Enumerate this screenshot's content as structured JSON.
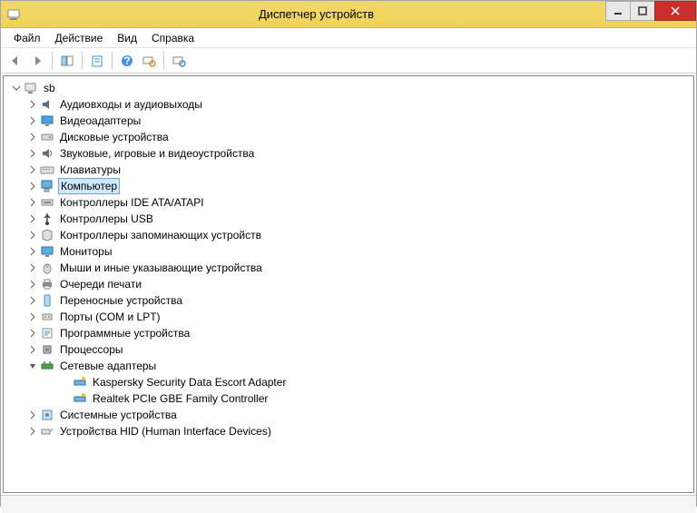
{
  "titlebar": {
    "title": "Диспетчер устройств"
  },
  "menus": {
    "file": "Файл",
    "action": "Действие",
    "view": "Вид",
    "help": "Справка"
  },
  "tree": {
    "root": "sb",
    "categories": [
      {
        "label": "Аудиовходы и аудиовыходы",
        "icon": "audio",
        "expanded": false,
        "selected": false
      },
      {
        "label": "Видеоадаптеры",
        "icon": "display",
        "expanded": false,
        "selected": false
      },
      {
        "label": "Дисковые устройства",
        "icon": "disk",
        "expanded": false,
        "selected": false
      },
      {
        "label": "Звуковые, игровые и видеоустройства",
        "icon": "sound",
        "expanded": false,
        "selected": false
      },
      {
        "label": "Клавиатуры",
        "icon": "keyboard",
        "expanded": false,
        "selected": false
      },
      {
        "label": "Компьютер",
        "icon": "computer",
        "expanded": false,
        "selected": true
      },
      {
        "label": "Контроллеры IDE ATA/ATAPI",
        "icon": "ide",
        "expanded": false,
        "selected": false
      },
      {
        "label": "Контроллеры USB",
        "icon": "usb",
        "expanded": false,
        "selected": false
      },
      {
        "label": "Контроллеры запоминающих устройств",
        "icon": "storage",
        "expanded": false,
        "selected": false
      },
      {
        "label": "Мониторы",
        "icon": "monitor",
        "expanded": false,
        "selected": false
      },
      {
        "label": "Мыши и иные указывающие устройства",
        "icon": "mouse",
        "expanded": false,
        "selected": false
      },
      {
        "label": "Очереди печати",
        "icon": "printer",
        "expanded": false,
        "selected": false
      },
      {
        "label": "Переносные устройства",
        "icon": "portable",
        "expanded": false,
        "selected": false
      },
      {
        "label": "Порты (COM и LPT)",
        "icon": "ports",
        "expanded": false,
        "selected": false
      },
      {
        "label": "Программные устройства",
        "icon": "software",
        "expanded": false,
        "selected": false
      },
      {
        "label": "Процессоры",
        "icon": "cpu",
        "expanded": false,
        "selected": false
      },
      {
        "label": "Сетевые адаптеры",
        "icon": "network",
        "expanded": true,
        "selected": false,
        "children": [
          {
            "label": "Kaspersky Security Data Escort Adapter",
            "icon": "netadapter"
          },
          {
            "label": "Realtek PCIe GBE Family Controller",
            "icon": "netadapter"
          }
        ]
      },
      {
        "label": "Системные устройства",
        "icon": "system",
        "expanded": false,
        "selected": false
      },
      {
        "label": "Устройства HID (Human Interface Devices)",
        "icon": "hid",
        "expanded": false,
        "selected": false
      }
    ]
  }
}
